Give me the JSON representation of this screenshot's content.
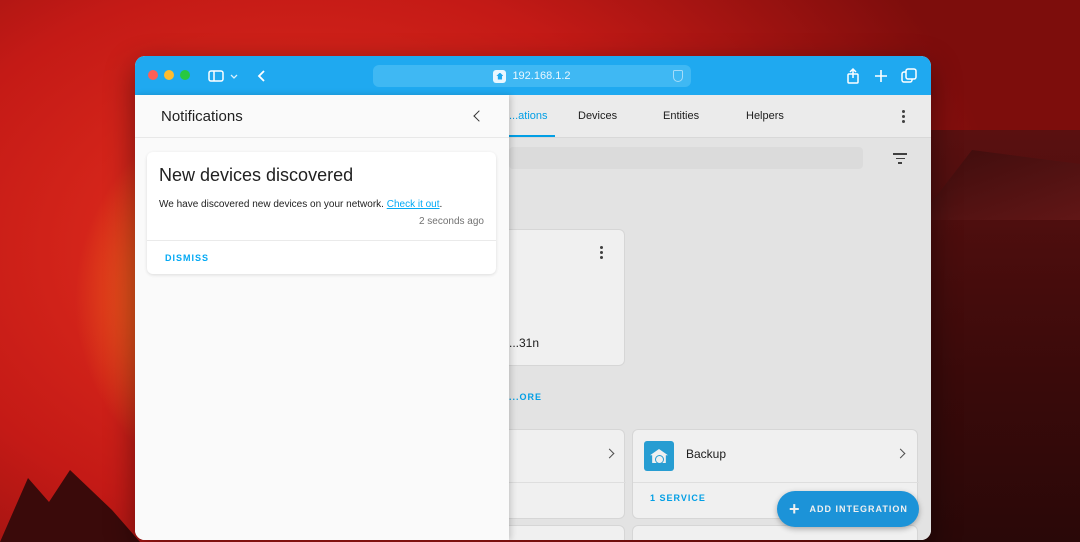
{
  "browser": {
    "url": "192.168.1.2"
  },
  "app": {
    "tabs": [
      "...ations",
      "Devices",
      "Entities",
      "Helpers"
    ],
    "card_partial_text": "...31n",
    "card_link_partial": "...ORE",
    "backup_card": {
      "title": "Backup",
      "link": "1 SERVICE"
    },
    "fab_label": "ADD INTEGRATION"
  },
  "notifications": {
    "title": "Notifications",
    "items": [
      {
        "title": "New devices discovered",
        "message": "We have discovered new devices on your network.",
        "link_text": "Check it out",
        "message_end": ".",
        "time": "2 seconds ago",
        "dismiss_label": "DISMISS"
      }
    ]
  },
  "colors": {
    "titlebar": "#1fa9f0",
    "accent": "#03a9f4"
  }
}
